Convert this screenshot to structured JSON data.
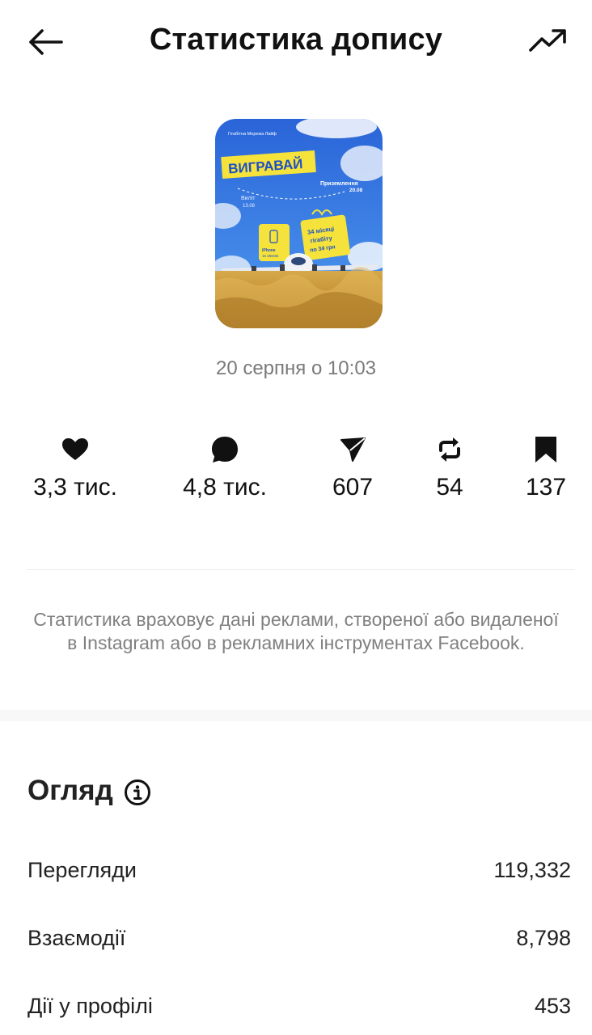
{
  "header": {
    "title": "Статистика допису"
  },
  "post": {
    "date": "20 серпня о 10:03",
    "thumbnail": {
      "brand": "Гігабітна Мережа Лайф",
      "headline": "ВИГРАВАЙ",
      "departure": "Виліт",
      "departure_date": "13.08",
      "landing": "Приземлення",
      "landing_date": "20.08",
      "prize1_line1": "iPhone",
      "prize1_line2": "16 256GB",
      "prize2_line1": "34 місяці",
      "prize2_line2": "гігабіту",
      "prize2_line3": "по 34 грн"
    }
  },
  "stats": [
    {
      "icon": "heart-icon",
      "value": "3,3 тис."
    },
    {
      "icon": "comment-icon",
      "value": "4,8 тис."
    },
    {
      "icon": "share-icon",
      "value": "607"
    },
    {
      "icon": "repost-icon",
      "value": "54"
    },
    {
      "icon": "bookmark-icon",
      "value": "137"
    }
  ],
  "disclaimer": "Статистика враховує дані реклами, створеної або видаленої в Instagram або в рекламних інструментах Facebook.",
  "overview": {
    "title": "Огляд",
    "rows": [
      {
        "label": "Перегляди",
        "value": "119,332"
      },
      {
        "label": "Взаємодії",
        "value": "8,798"
      },
      {
        "label": "Дії у профілі",
        "value": "453"
      }
    ]
  },
  "colors": {
    "text": "#111111",
    "muted": "#7a7a7a",
    "thumb_sky": "#2f6fe0",
    "thumb_yellow": "#f5e23a",
    "thumb_wheat": "#c9972f"
  }
}
